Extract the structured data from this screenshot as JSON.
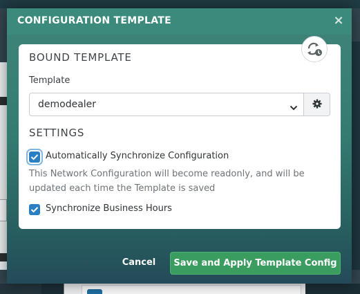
{
  "modal": {
    "title": "CONFIGURATION TEMPLATE",
    "close_symbol": "×",
    "close_icon": "close-icon"
  },
  "bound_template": {
    "heading": "BOUND TEMPLATE",
    "sync_icon": "sync-badge-icon",
    "template_label": "Template",
    "template_value": "demodealer",
    "select_icon": "chevron-down-icon",
    "settings_icon": "gear-icon"
  },
  "settings": {
    "heading": "SETTINGS",
    "auto_sync": {
      "label": "Automatically Synchronize Configuration",
      "checked": true,
      "help": "This Network Configuration will become readonly, and will be updated each time the Template is saved"
    },
    "sync_hours": {
      "label": "Synchronize Business Hours",
      "checked": true
    }
  },
  "footer": {
    "cancel_label": "Cancel",
    "save_label": "Save and Apply Template Config"
  },
  "colors": {
    "header": "#3b8a7b",
    "primary_button": "#3a9d5f",
    "checkbox": "#2a7fc2"
  }
}
